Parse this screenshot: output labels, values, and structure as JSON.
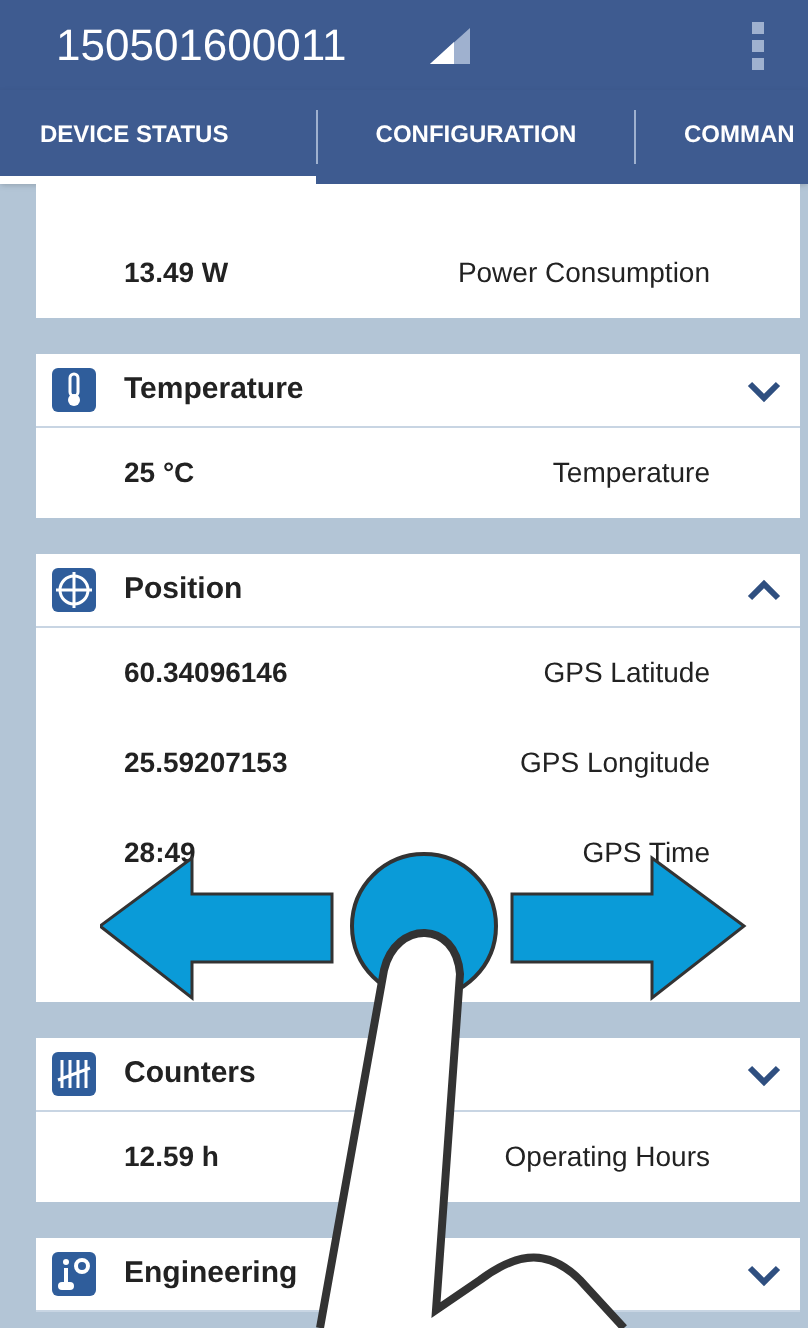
{
  "app_bar": {
    "title": "150501600011"
  },
  "tabs": [
    {
      "label": "DEVICE STATUS",
      "selected": true
    },
    {
      "label": "CONFIGURATION",
      "selected": false
    },
    {
      "label": "COMMAN",
      "selected": false
    }
  ],
  "cards": [
    {
      "kind": "partial",
      "rows": [
        {
          "value": "13.49 W",
          "label": "Power Consumption"
        }
      ]
    },
    {
      "kind": "temperature",
      "title": "Temperature",
      "expanded": false,
      "rows": [
        {
          "value": "25 °C",
          "label": "Temperature"
        }
      ]
    },
    {
      "kind": "position",
      "title": "Position",
      "expanded": true,
      "rows": [
        {
          "value": "60.34096146",
          "label": "GPS Latitude"
        },
        {
          "value": "25.59207153",
          "label": "GPS Longitude"
        },
        {
          "value": "28:49",
          "label": "GPS Time"
        }
      ]
    },
    {
      "kind": "counters",
      "title": "Counters",
      "expanded": false,
      "rows": [
        {
          "value": "12.59 h",
          "label": "Operating Hours"
        }
      ]
    },
    {
      "kind": "engineering",
      "title": "Engineering",
      "expanded": false
    }
  ]
}
